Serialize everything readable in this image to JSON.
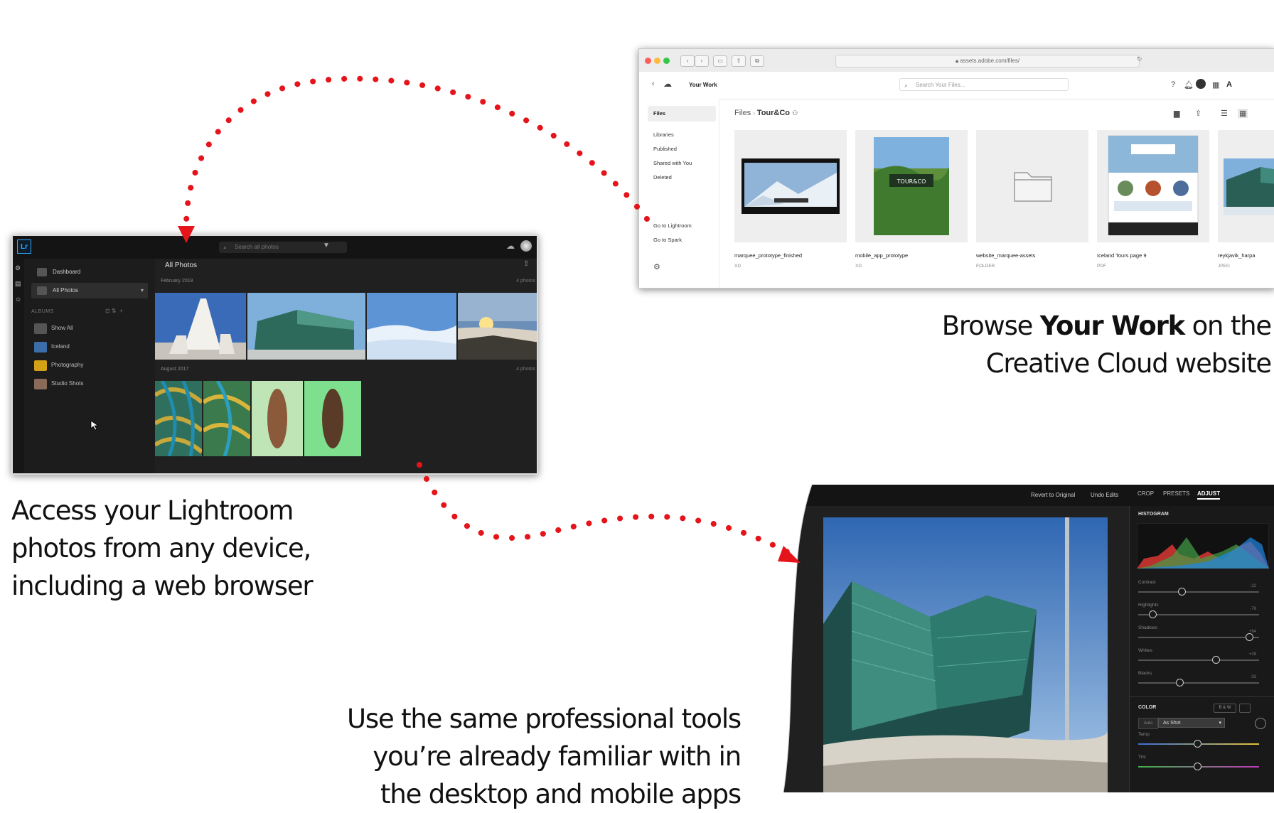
{
  "lightroom": {
    "app_badge": "Lr",
    "search_placeholder": "Search all photos",
    "nav": [
      {
        "label": "Dashboard",
        "active": false
      },
      {
        "label": "All Photos",
        "active": true
      }
    ],
    "albums_header": "ALBUMS",
    "albums": [
      {
        "label": "Show All",
        "color": "#555555"
      },
      {
        "label": "Iceland",
        "color": "#3b6ea8"
      },
      {
        "label": "Photography",
        "color": "#d4a017"
      },
      {
        "label": "Studio Shots",
        "color": "#8a6b5a"
      }
    ],
    "main_title": "All Photos",
    "groups": [
      {
        "date": "February 2018",
        "count": "4 photos"
      },
      {
        "date": "August 2017",
        "count": "4 photos"
      }
    ]
  },
  "creative_cloud": {
    "url": "assets.adobe.com/files/",
    "title": "Your Work",
    "search_placeholder": "Search Your Files...",
    "sidebar": {
      "active": "Files",
      "items": [
        "Libraries",
        "Published",
        "Shared with You",
        "Deleted"
      ],
      "links": [
        "Go to Lightroom",
        "Go to Spark"
      ]
    },
    "breadcrumb": {
      "root": "Files",
      "current": "Tour&Co"
    },
    "files": [
      {
        "name": "marquee_prototype_finished",
        "type": "XD"
      },
      {
        "name": "mobile_app_prototype",
        "type": "XD"
      },
      {
        "name": "website_marquee-assets",
        "type": "FOLDER"
      },
      {
        "name": "Iceland Tours page 9",
        "type": "PDF"
      },
      {
        "name": "reykjavik_harpa",
        "type": "JPEG"
      }
    ],
    "thumb_text": {
      "tour": "TOUR&CO"
    }
  },
  "editor": {
    "top_links": [
      "Revert to Original",
      "Undo Edits"
    ],
    "tabs": [
      {
        "label": "CROP",
        "active": false
      },
      {
        "label": "PRESETS",
        "active": false
      },
      {
        "label": "ADJUST",
        "active": true
      }
    ],
    "histogram_label": "HISTOGRAM",
    "sliders": [
      {
        "label": "Contrast",
        "value": "-22",
        "level": 0.36
      },
      {
        "label": "Highlights",
        "value": "-76",
        "level": 0.12
      },
      {
        "label": "Shadows",
        "value": "+84",
        "level": 0.92
      },
      {
        "label": "Whites",
        "value": "+28",
        "level": 0.64
      },
      {
        "label": "Blacks",
        "value": "-33",
        "level": 0.34
      }
    ],
    "color_label": "COLOR",
    "bw_label": "B & W",
    "wb_label": "As Shot",
    "wb_prefix": "Auto",
    "temp_label": "Temp",
    "tint_label": "Tint"
  },
  "captions": {
    "browse": {
      "pre": "Browse ",
      "bold": "Your Work",
      "post": " on the",
      "line2": "Creative Cloud website"
    },
    "access": [
      "Access your Lightroom",
      "photos from any device,",
      "including a web browser"
    ],
    "tools": [
      "Use the same professional tools",
      "you’re already familiar with in",
      "the desktop and mobile apps"
    ]
  },
  "colors": {
    "arrow": "#e5141b",
    "lr_accent": "#31a8ff"
  }
}
